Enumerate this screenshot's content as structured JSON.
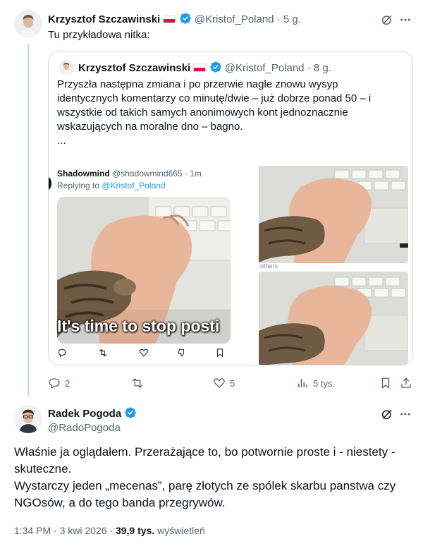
{
  "tweet1": {
    "name": "Krzysztof Szczawinski",
    "handle": "@Kristof_Poland",
    "time": "· 5 g.",
    "text": "Tu przykładowa nitka:",
    "quote": {
      "name": "Krzysztof Szczawinski",
      "handle": "@Kristof_Poland",
      "time": "· 8 g.",
      "text_lines": [
        "Przyszła następna zmiana i po przerwie nagle znowu wysyp",
        "identycznych komentarzy co minutę/dwie – już dobrze ponad 50 – i",
        "wszystkie od takich samych anonimowych kont jednoznacznie",
        "wskazujących na moralne dno – bagno.",
        "..."
      ],
      "screenshot": {
        "name": "Shadowmind",
        "handle": "@shadowmind665 · 1m",
        "replying_prefix": "Replying to ",
        "replying_handle": "@Kristof_Poland",
        "caption": "It's time to stop posti",
        "side_text": "others"
      }
    },
    "stats": {
      "replies": "2",
      "retweets": "",
      "likes": "5",
      "views": "5 tys."
    }
  },
  "tweet2": {
    "name": "Radek Pogoda",
    "handle": "@RadoPogoda",
    "body_lines": [
      "Właśnie ja oglądałem. Przerażające to, bo potwornie proste i - niestety -",
      "skuteczne.",
      "Wystarczy jeden „mecenas”, parę złotych ze spólek skarbu panstwa czy",
      "NGOsów, a do tego banda przegrywów."
    ],
    "meta_time": "1:34 PM · 3 kwi 2026 ·",
    "views_count": "39,9 tys.",
    "views_label": "wyświetleń"
  },
  "colors": {
    "verified": "#1d9bf0",
    "muted": "#536471",
    "border": "#cfd9de",
    "link": "#1d9bf0"
  }
}
